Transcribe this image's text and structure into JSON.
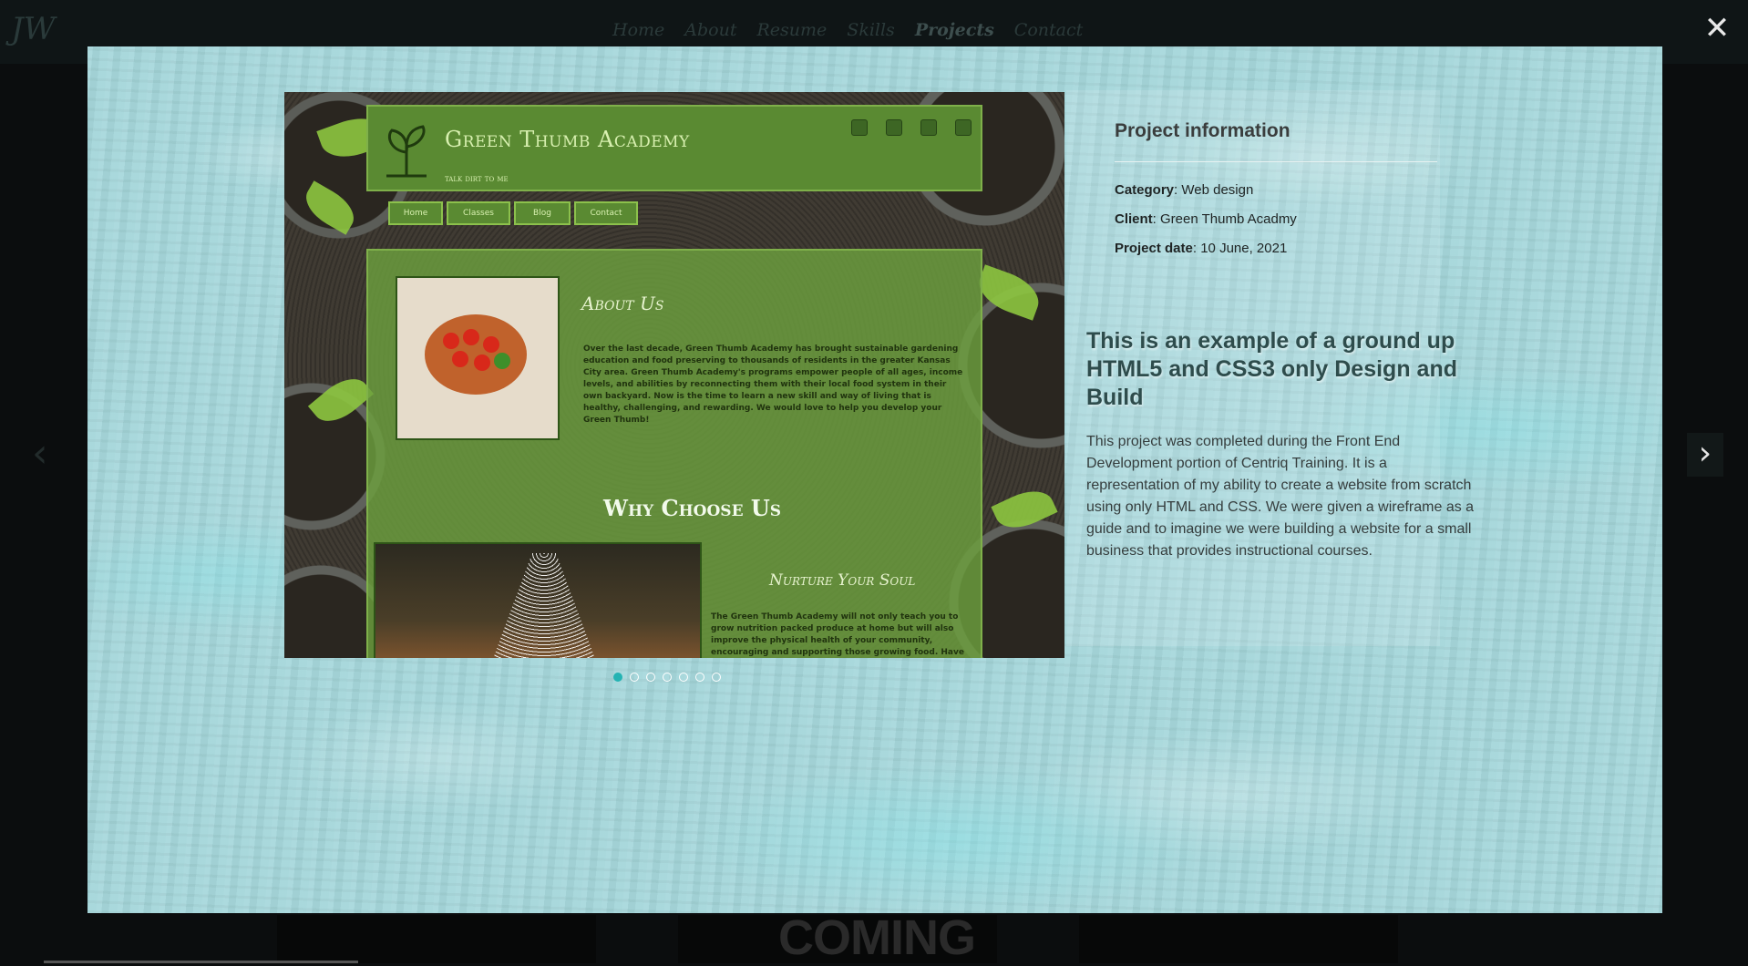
{
  "background": {
    "logo": "JW",
    "nav": [
      "Home",
      "About",
      "Resume",
      "Skills",
      "Projects",
      "Contact"
    ],
    "coming_text": "COMING"
  },
  "modal": {
    "screenshot": {
      "site_title": "Green Thumb Academy",
      "site_tagline": "talk dirt to me",
      "nav": [
        "Home",
        "Classes",
        "Blog",
        "Contact"
      ],
      "about_title": "About Us",
      "about_text": "Over the last decade, Green Thumb Academy has brought sustainable gardening education and food preserving to thousands of residents in the greater Kansas City area. Green Thumb Academy's programs empower people of all ages, income levels, and abilities by reconnecting them with their local food system in their own backyard. Now is the time to learn a new skill and way of living that is healthy, challenging, and rewarding. We would love to help you develop your Green Thumb!",
      "why_title": "Why Choose Us",
      "nurture_title": "Nurture Your Soul",
      "nurture_text": "The Green Thumb Academy will not only teach you to grow nutrition packed produce at home but will also improve the physical health of your community, encouraging and supporting those growing food. Have you ever wondered where your food comes from? Are you"
    },
    "slides_total": 7,
    "active_slide": 1,
    "info": {
      "title": "Project information",
      "category_label": "Category",
      "category_value": "Web design",
      "client_label": "Client",
      "client_value": "Green Thumb Acadmy",
      "date_label": "Project date",
      "date_value": "10 June, 2021"
    },
    "headline": "This is an example of a ground up HTML5 and CSS3 only Design and Build",
    "description": "This project was completed during the Front End Development portion of Centriq Training. It is a representation of my ability to create a website from scratch using only HTML and CSS. We were given a wireframe as a guide and to imagine we were building a website for a small business that provides instructional courses."
  },
  "controls": {
    "close": "✕",
    "prev": "‹",
    "next": "›"
  },
  "colors": {
    "accent": "#24b3b3",
    "modal_bg": "#a6d7db"
  }
}
